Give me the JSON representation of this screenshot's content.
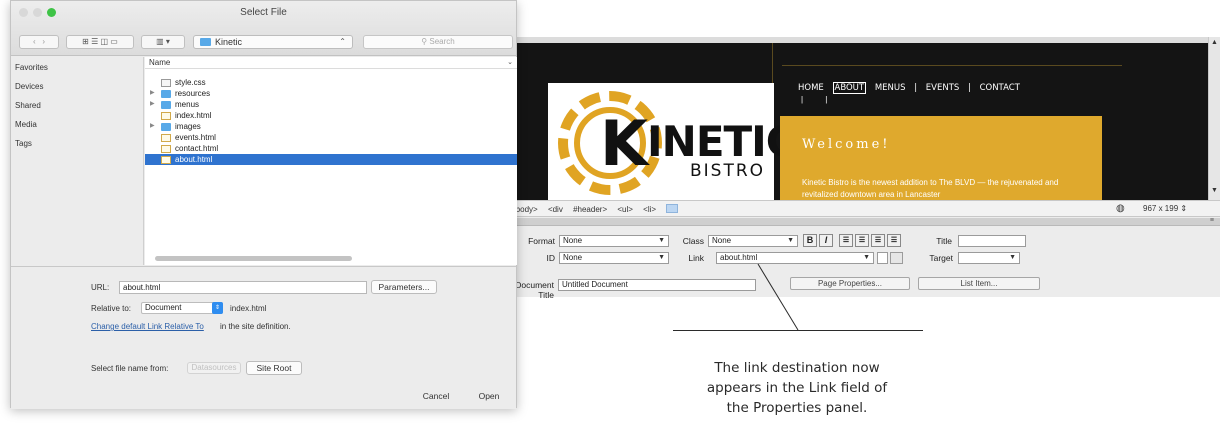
{
  "dialog": {
    "title": "Select File",
    "path_folder": "Kinetic",
    "search_placeholder": "Search",
    "sidebar": [
      "Favorites",
      "Devices",
      "Shared",
      "Media",
      "Tags"
    ],
    "list_header": "Name",
    "files": [
      {
        "name": "style.css",
        "type": "css",
        "expandable": false
      },
      {
        "name": "resources",
        "type": "folder",
        "expandable": true
      },
      {
        "name": "menus",
        "type": "folder",
        "expandable": true
      },
      {
        "name": "index.html",
        "type": "html",
        "expandable": false
      },
      {
        "name": "images",
        "type": "folder",
        "expandable": true
      },
      {
        "name": "events.html",
        "type": "html",
        "expandable": false
      },
      {
        "name": "contact.html",
        "type": "html",
        "expandable": false
      },
      {
        "name": "about.html",
        "type": "html",
        "expandable": false,
        "selected": true
      }
    ],
    "url_label": "URL:",
    "url_value": "about.html",
    "parameters_button": "Parameters...",
    "relative_label": "Relative to:",
    "relative_value": "Document",
    "relative_file": "index.html",
    "change_link": "Change default Link Relative To",
    "change_suffix": " in the site definition.",
    "select_from_label": "Select file name from:",
    "file_system_button": "Datasources",
    "site_root_button": "Site Root",
    "cancel_button": "Cancel",
    "open_button": "Open"
  },
  "dreamweaver": {
    "site": {
      "logo_k": "K",
      "logo_rest": "INETIC",
      "logo_sub": "BISTRO",
      "nav": [
        "HOME",
        "ABOUT",
        "MENUS",
        "|",
        "EVENTS",
        "|",
        "CONTACT"
      ],
      "welcome_title": "Welcome!",
      "welcome_text": "Kinetic Bistro is the newest addition to The BLVD — the rejuvenated and revitalized downtown area in Lancaster"
    },
    "tag_selector": [
      "<body>",
      "<div",
      "#header>",
      "<ul>",
      "<li>"
    ],
    "window_size": "967 x 199",
    "properties": {
      "format_label": "Format",
      "format_value": "None",
      "class_label": "Class",
      "class_value": "None",
      "id_label": "ID",
      "id_value": "None",
      "link_label": "Link",
      "link_value": "about.html",
      "title_label": "Title",
      "title_value": "",
      "target_label": "Target",
      "target_value": "",
      "doc_title_label": "Document Title",
      "doc_title_value": "Untitled Document",
      "page_properties_button": "Page Properties...",
      "list_item_button": "List Item...",
      "bold_label": "B",
      "italic_label": "I"
    }
  },
  "caption": [
    "The link destination now",
    "appears in the Link field of",
    "the Properties panel."
  ],
  "colors": {
    "selection": "#2f73cf",
    "folder": "#58a9e8",
    "welcome_bg": "#dfa92d"
  }
}
